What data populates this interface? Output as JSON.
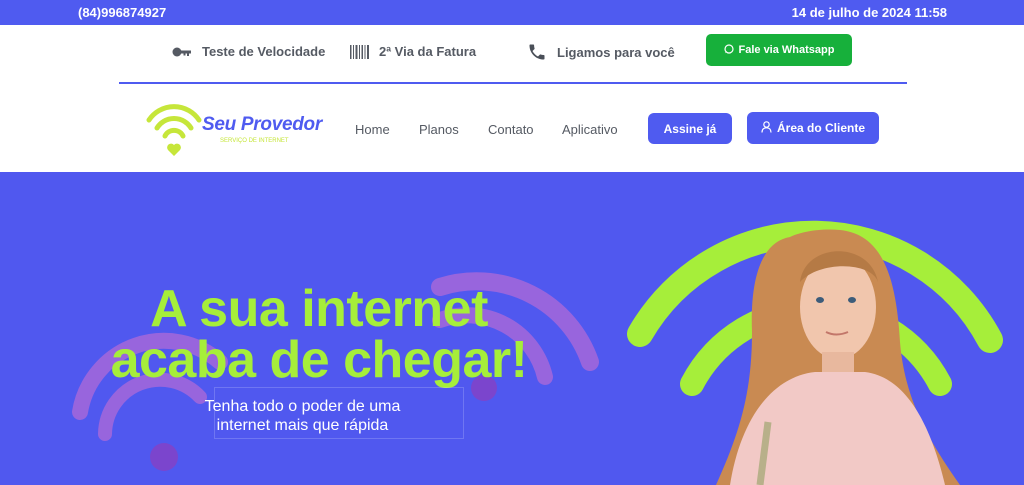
{
  "topbar": {
    "phone": "(84)996874927",
    "datetime": "14 de julho de 2024 11:58"
  },
  "utility": {
    "speed_test": "Teste de Velocidade",
    "invoice": "2ª Via da Fatura",
    "callback": "Ligamos para você",
    "whatsapp": "Fale via Whatsapp"
  },
  "logo": {
    "name": "Seu Provedor",
    "tagline": "SERVIÇO DE INTERNET"
  },
  "nav": {
    "items": [
      "Home",
      "Planos",
      "Contato",
      "Aplicativo"
    ],
    "subscribe": "Assine já",
    "client_area": "Área do Cliente"
  },
  "hero": {
    "title_line1": "A sua internet",
    "title_line2": "acaba de chegar!",
    "subtitle_line1": "Tenha todo o poder de uma",
    "subtitle_line2": "internet mais que rápida"
  },
  "colors": {
    "brand_blue": "#4f5bf0",
    "lime": "#a6ee3a",
    "whatsapp_green": "#17b03b",
    "text_gray": "#555a63"
  },
  "icons": [
    "key-icon",
    "barcode-icon",
    "phone-icon",
    "whatsapp-icon",
    "wifi-logo-icon",
    "user-icon",
    "wifi-graphic-icon"
  ]
}
